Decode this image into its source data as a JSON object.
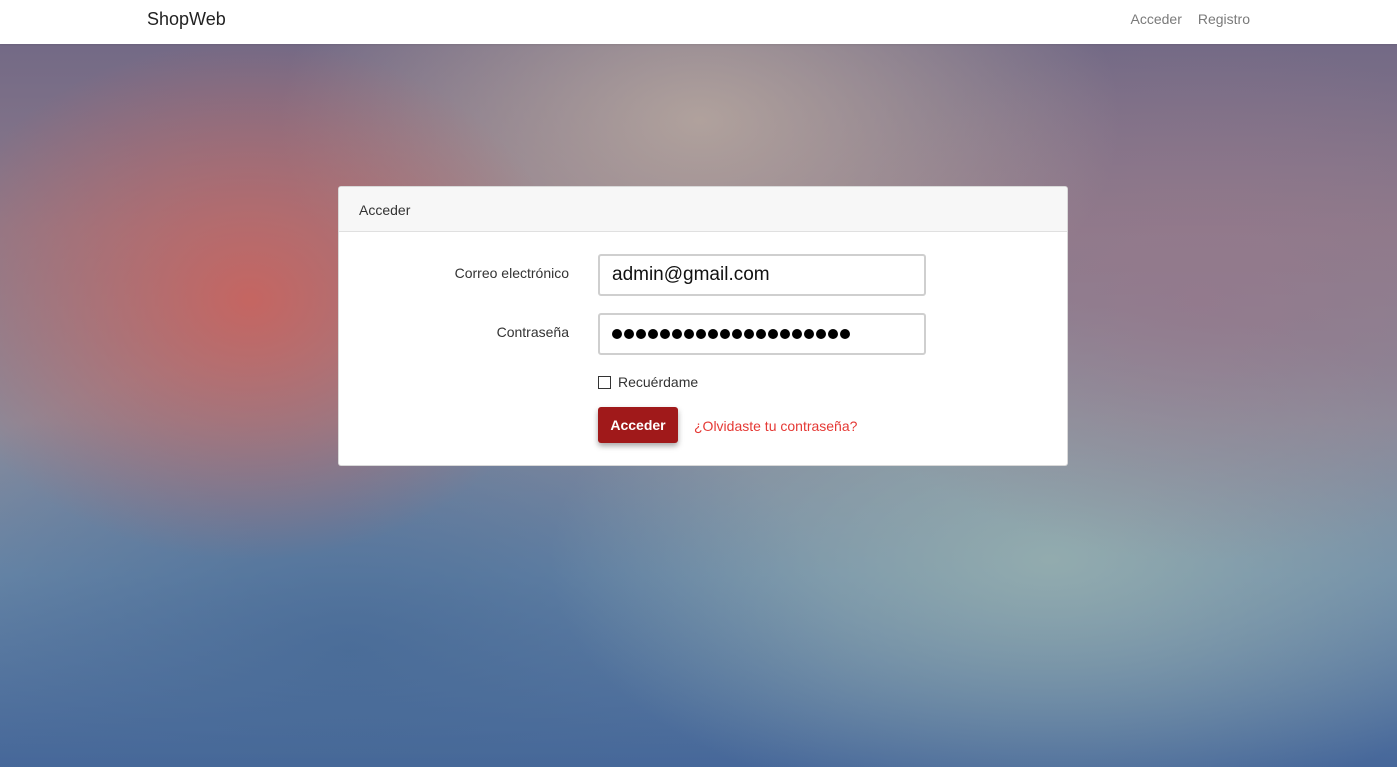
{
  "navbar": {
    "brand": "ShopWeb",
    "links": [
      {
        "label": "Acceder"
      },
      {
        "label": "Registro"
      }
    ]
  },
  "login": {
    "header": "Acceder",
    "email_label": "Correo electrónico",
    "email_value": "admin@gmail.com",
    "password_label": "Contraseña",
    "password_dot_count": 20,
    "remember_label": "Recuérdame",
    "remember_checked": false,
    "submit_label": "Acceder",
    "forgot_link": "¿Olvidaste tu contraseña?"
  },
  "colors": {
    "primary_button": "#a0191a",
    "link": "#e53935"
  }
}
